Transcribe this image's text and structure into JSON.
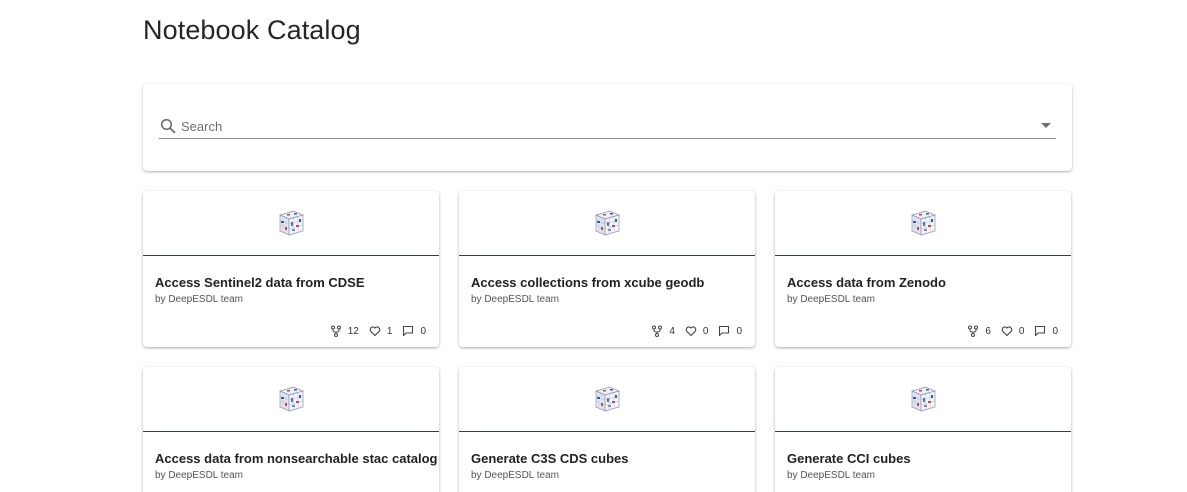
{
  "page": {
    "title": "Notebook Catalog"
  },
  "search": {
    "placeholder": "Search",
    "value": ""
  },
  "notebooks": [
    {
      "title": "Access Sentinel2 data from CDSE",
      "author": "by DeepESDL team",
      "forks": "12",
      "likes": "1",
      "comments": "0"
    },
    {
      "title": "Access collections from xcube geodb",
      "author": "by DeepESDL team",
      "forks": "4",
      "likes": "0",
      "comments": "0"
    },
    {
      "title": "Access data from Zenodo",
      "author": "by DeepESDL team",
      "forks": "6",
      "likes": "0",
      "comments": "0"
    },
    {
      "title": "Access data from nonsearchable stac catalog",
      "author": "by DeepESDL team"
    },
    {
      "title": "Generate C3S CDS cubes",
      "author": "by DeepESDL team"
    },
    {
      "title": "Generate CCI cubes",
      "author": "by DeepESDL team"
    }
  ],
  "icons": {
    "search": "search-icon",
    "dropdown": "arrow-drop-down-icon",
    "thumbnail": "data-cube-icon",
    "forks": "fork-icon",
    "likes": "heart-icon",
    "comments": "comment-icon"
  },
  "colors": {
    "card_divider": "#2e3f57",
    "cube_blue": "#3b5aa8",
    "cube_red": "#c24a3a"
  }
}
